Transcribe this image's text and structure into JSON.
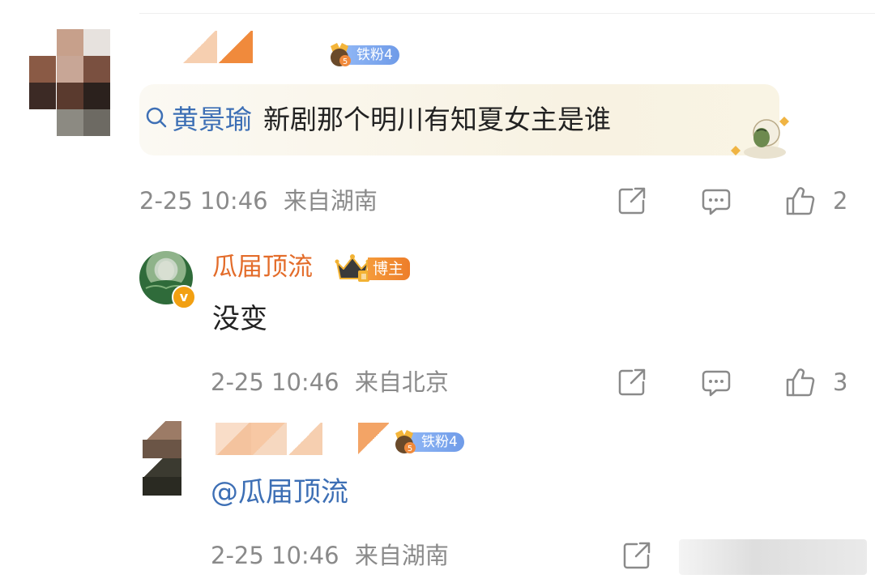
{
  "comment": {
    "fan_badge": "铁粉4",
    "topic_link": "黄景瑜",
    "text": "新剧那个明川有知夏女主是谁",
    "time": "2-25 10:46",
    "location": "来自湖南",
    "like_count": "2"
  },
  "reply1": {
    "username": "瓜届顶流",
    "role_badge": "博主",
    "level": "Ⅲ",
    "verified": "v",
    "text": "没变",
    "time": "2-25 10:46",
    "location": "来自北京",
    "like_count": "3"
  },
  "reply2": {
    "fan_badge": "铁粉4",
    "text": "@瓜届顶流",
    "time": "2-25 10:46",
    "location": "来自湖南"
  },
  "colors": {
    "link": "#3d6fb5",
    "blogger_name": "#e36c2a",
    "meta": "#8a8a8a",
    "fan_badge": "#6f9be8",
    "blogger_badge": "#ed7d2a"
  },
  "icons": [
    "share-icon",
    "comment-icon",
    "like-icon",
    "search-icon",
    "crown-icon",
    "fan-medal-icon"
  ]
}
